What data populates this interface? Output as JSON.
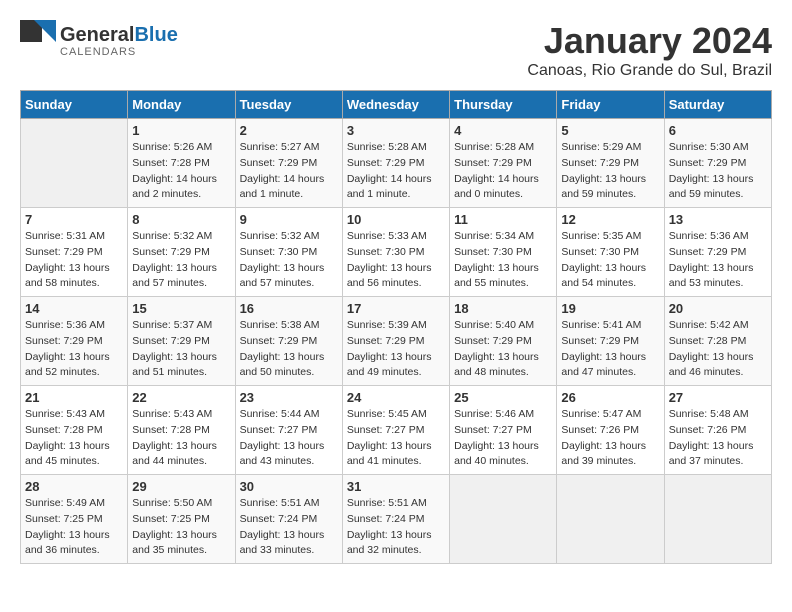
{
  "header": {
    "logo_general": "General",
    "logo_blue": "Blue",
    "month_title": "January 2024",
    "location": "Canoas, Rio Grande do Sul, Brazil"
  },
  "weekdays": [
    "Sunday",
    "Monday",
    "Tuesday",
    "Wednesday",
    "Thursday",
    "Friday",
    "Saturday"
  ],
  "weeks": [
    [
      {
        "day": null
      },
      {
        "day": 1,
        "sunrise": "5:26 AM",
        "sunset": "7:28 PM",
        "daylight": "14 hours and 2 minutes."
      },
      {
        "day": 2,
        "sunrise": "5:27 AM",
        "sunset": "7:29 PM",
        "daylight": "14 hours and 1 minute."
      },
      {
        "day": 3,
        "sunrise": "5:28 AM",
        "sunset": "7:29 PM",
        "daylight": "14 hours and 1 minute."
      },
      {
        "day": 4,
        "sunrise": "5:28 AM",
        "sunset": "7:29 PM",
        "daylight": "14 hours and 0 minutes."
      },
      {
        "day": 5,
        "sunrise": "5:29 AM",
        "sunset": "7:29 PM",
        "daylight": "13 hours and 59 minutes."
      },
      {
        "day": 6,
        "sunrise": "5:30 AM",
        "sunset": "7:29 PM",
        "daylight": "13 hours and 59 minutes."
      }
    ],
    [
      {
        "day": 7,
        "sunrise": "5:31 AM",
        "sunset": "7:29 PM",
        "daylight": "13 hours and 58 minutes."
      },
      {
        "day": 8,
        "sunrise": "5:32 AM",
        "sunset": "7:29 PM",
        "daylight": "13 hours and 57 minutes."
      },
      {
        "day": 9,
        "sunrise": "5:32 AM",
        "sunset": "7:30 PM",
        "daylight": "13 hours and 57 minutes."
      },
      {
        "day": 10,
        "sunrise": "5:33 AM",
        "sunset": "7:30 PM",
        "daylight": "13 hours and 56 minutes."
      },
      {
        "day": 11,
        "sunrise": "5:34 AM",
        "sunset": "7:30 PM",
        "daylight": "13 hours and 55 minutes."
      },
      {
        "day": 12,
        "sunrise": "5:35 AM",
        "sunset": "7:30 PM",
        "daylight": "13 hours and 54 minutes."
      },
      {
        "day": 13,
        "sunrise": "5:36 AM",
        "sunset": "7:29 PM",
        "daylight": "13 hours and 53 minutes."
      }
    ],
    [
      {
        "day": 14,
        "sunrise": "5:36 AM",
        "sunset": "7:29 PM",
        "daylight": "13 hours and 52 minutes."
      },
      {
        "day": 15,
        "sunrise": "5:37 AM",
        "sunset": "7:29 PM",
        "daylight": "13 hours and 51 minutes."
      },
      {
        "day": 16,
        "sunrise": "5:38 AM",
        "sunset": "7:29 PM",
        "daylight": "13 hours and 50 minutes."
      },
      {
        "day": 17,
        "sunrise": "5:39 AM",
        "sunset": "7:29 PM",
        "daylight": "13 hours and 49 minutes."
      },
      {
        "day": 18,
        "sunrise": "5:40 AM",
        "sunset": "7:29 PM",
        "daylight": "13 hours and 48 minutes."
      },
      {
        "day": 19,
        "sunrise": "5:41 AM",
        "sunset": "7:29 PM",
        "daylight": "13 hours and 47 minutes."
      },
      {
        "day": 20,
        "sunrise": "5:42 AM",
        "sunset": "7:28 PM",
        "daylight": "13 hours and 46 minutes."
      }
    ],
    [
      {
        "day": 21,
        "sunrise": "5:43 AM",
        "sunset": "7:28 PM",
        "daylight": "13 hours and 45 minutes."
      },
      {
        "day": 22,
        "sunrise": "5:43 AM",
        "sunset": "7:28 PM",
        "daylight": "13 hours and 44 minutes."
      },
      {
        "day": 23,
        "sunrise": "5:44 AM",
        "sunset": "7:27 PM",
        "daylight": "13 hours and 43 minutes."
      },
      {
        "day": 24,
        "sunrise": "5:45 AM",
        "sunset": "7:27 PM",
        "daylight": "13 hours and 41 minutes."
      },
      {
        "day": 25,
        "sunrise": "5:46 AM",
        "sunset": "7:27 PM",
        "daylight": "13 hours and 40 minutes."
      },
      {
        "day": 26,
        "sunrise": "5:47 AM",
        "sunset": "7:26 PM",
        "daylight": "13 hours and 39 minutes."
      },
      {
        "day": 27,
        "sunrise": "5:48 AM",
        "sunset": "7:26 PM",
        "daylight": "13 hours and 37 minutes."
      }
    ],
    [
      {
        "day": 28,
        "sunrise": "5:49 AM",
        "sunset": "7:25 PM",
        "daylight": "13 hours and 36 minutes."
      },
      {
        "day": 29,
        "sunrise": "5:50 AM",
        "sunset": "7:25 PM",
        "daylight": "13 hours and 35 minutes."
      },
      {
        "day": 30,
        "sunrise": "5:51 AM",
        "sunset": "7:24 PM",
        "daylight": "13 hours and 33 minutes."
      },
      {
        "day": 31,
        "sunrise": "5:51 AM",
        "sunset": "7:24 PM",
        "daylight": "13 hours and 32 minutes."
      },
      {
        "day": null
      },
      {
        "day": null
      },
      {
        "day": null
      }
    ]
  ]
}
